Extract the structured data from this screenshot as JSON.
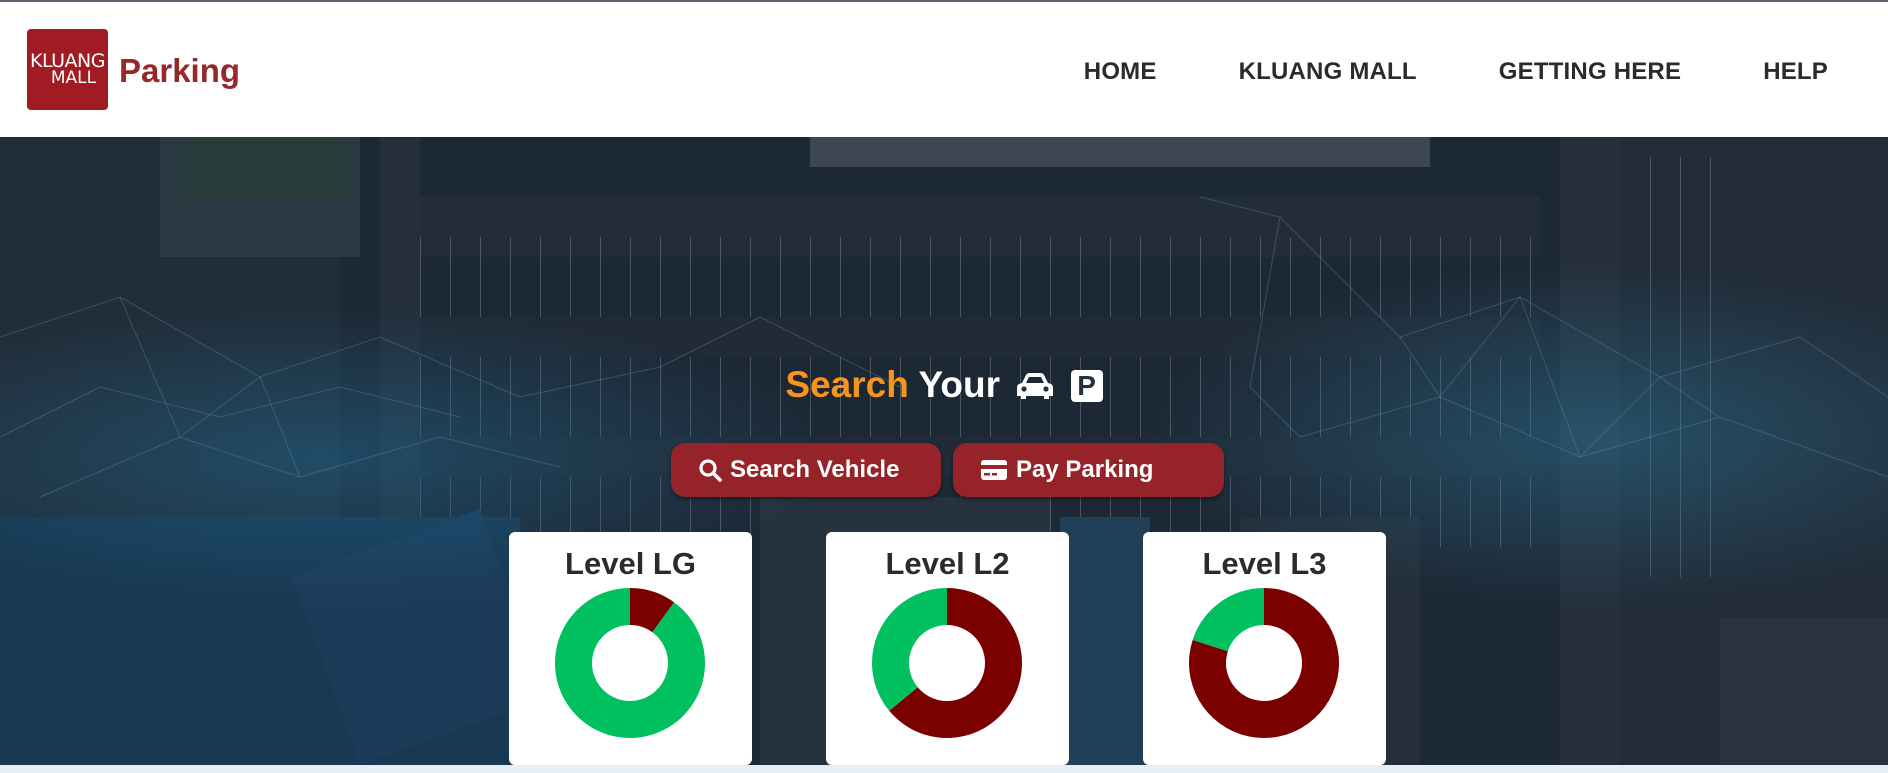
{
  "brand": {
    "logo_line1": "KLUANG",
    "logo_line2": "MALL",
    "name": "Parking",
    "color": "#96282c"
  },
  "nav": [
    {
      "label": "HOME"
    },
    {
      "label": "KLUANG MALL"
    },
    {
      "label": "GETTING HERE"
    },
    {
      "label": "HELP"
    }
  ],
  "hero": {
    "title_accent": "Search",
    "title_rest": "Your",
    "car_icon": "car-icon",
    "parking_icon": "parking-icon",
    "parking_letter": "P",
    "accent_color": "#f7941d"
  },
  "actions": {
    "search_label": "Search Vehicle",
    "search_icon": "search-icon",
    "pay_label": "Pay Parking",
    "pay_icon": "credit-card-icon",
    "button_color": "#96232a"
  },
  "chart_data": [
    {
      "type": "pie",
      "title": "Level LG",
      "slices": [
        {
          "value": 10,
          "color": "#7b0000"
        },
        {
          "value": 90,
          "color": "#00c060"
        }
      ]
    },
    {
      "type": "pie",
      "title": "Level L2",
      "slices": [
        {
          "value": 64,
          "color": "#7b0000"
        },
        {
          "value": 36,
          "color": "#00c060"
        }
      ]
    },
    {
      "type": "pie",
      "title": "Level L3",
      "slices": [
        {
          "value": 80,
          "color": "#7b0000"
        },
        {
          "value": 20,
          "color": "#00c060"
        }
      ]
    }
  ]
}
